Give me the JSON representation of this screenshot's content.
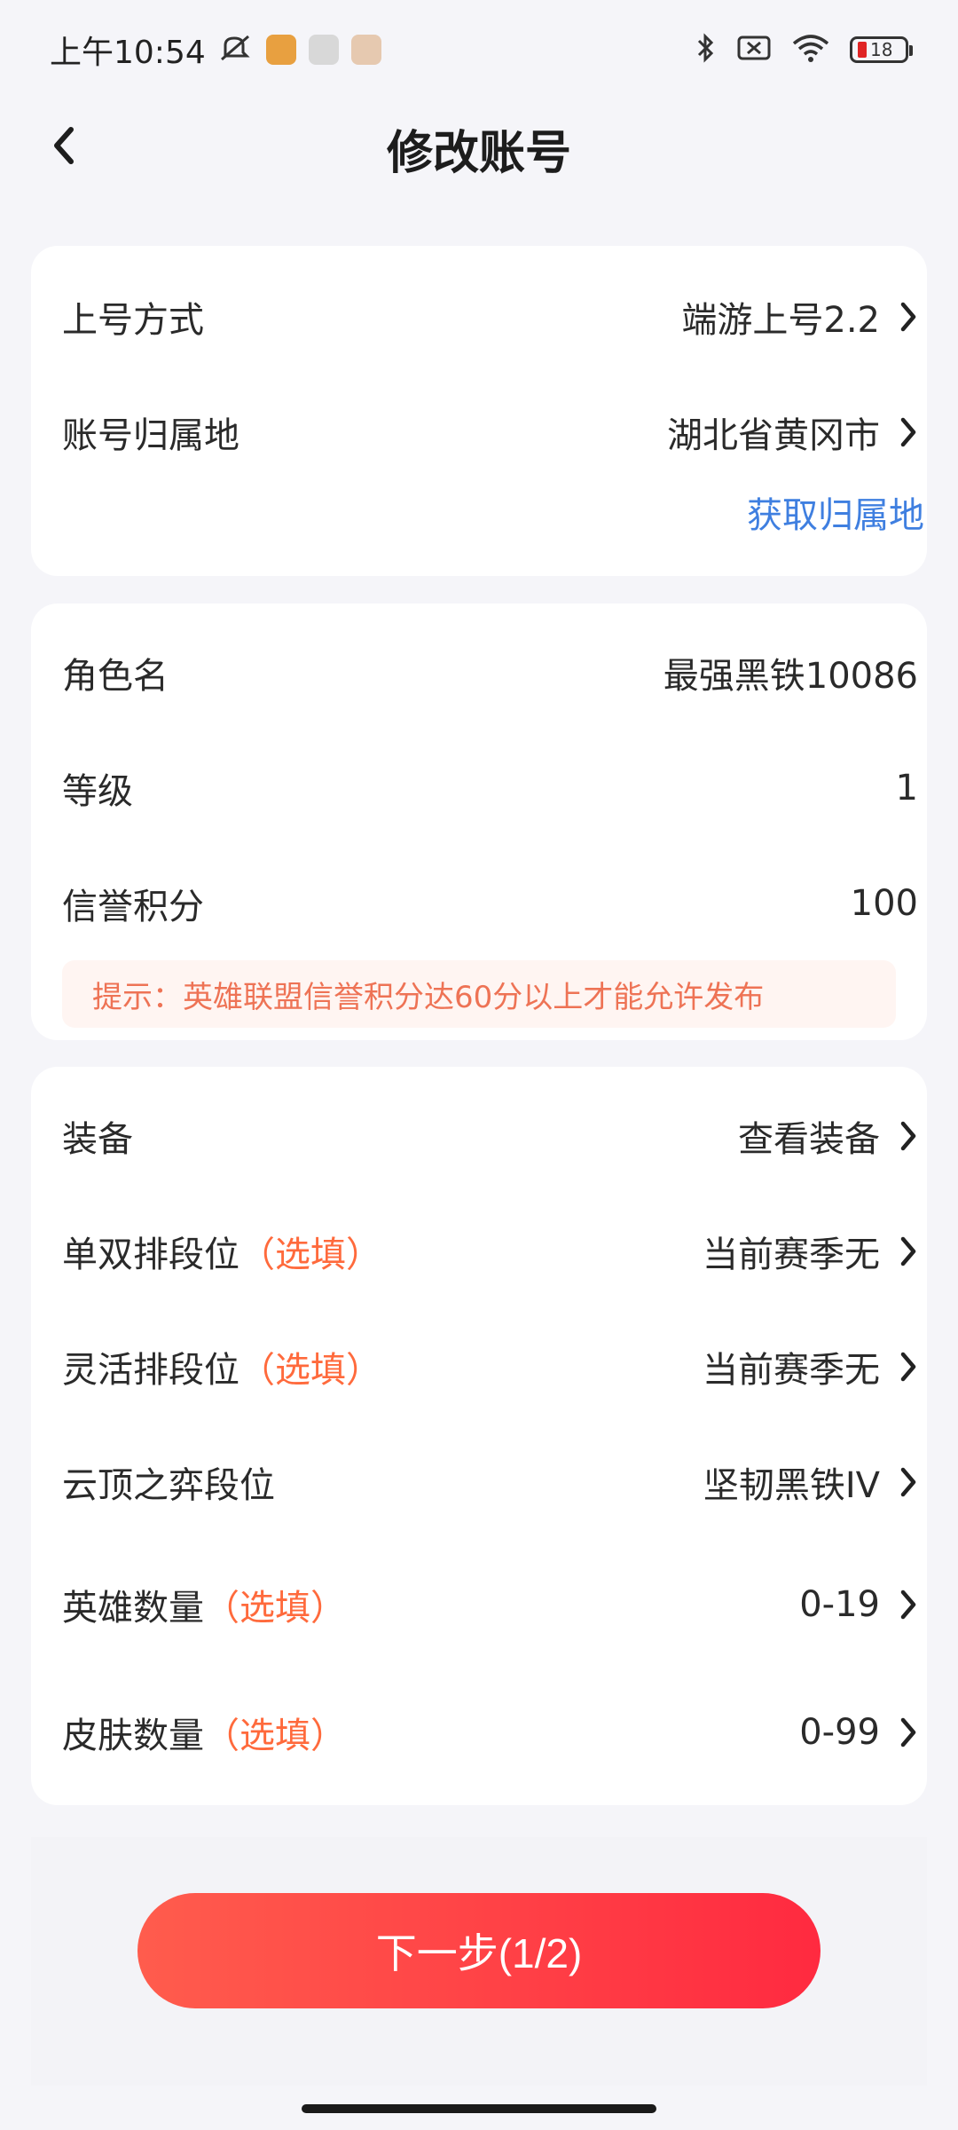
{
  "status_bar": {
    "time": "上午10:54",
    "battery_level": "18",
    "colors": {
      "battery_low": "#e02424"
    }
  },
  "nav": {
    "title": "修改账号"
  },
  "section1": {
    "login_method_label": "上号方式",
    "login_method_value": "端游上号2.2",
    "region_label": "账号归属地",
    "region_value": "湖北省黄冈市",
    "get_region_link": "获取归属地"
  },
  "section2": {
    "role_name_label": "角色名",
    "role_name_value": "最强黑铁10086",
    "level_label": "等级",
    "level_value": "1",
    "credit_label": "信誉积分",
    "credit_value": "100",
    "hint": "提示：英雄联盟信誉积分达60分以上才能允许发布"
  },
  "section3": {
    "optional_tag": "（选填）",
    "equipment_label": "装备",
    "equipment_value": "查看装备",
    "solo_rank_label": "单双排段位",
    "solo_rank_value": "当前赛季无",
    "flex_rank_label": "灵活排段位",
    "flex_rank_value": "当前赛季无",
    "tft_rank_label": "云顶之弈段位",
    "tft_rank_value": "坚韧黑铁IV",
    "hero_count_label": "英雄数量",
    "hero_count_value": "0-19",
    "skin_count_label": "皮肤数量",
    "skin_count_value": "0-99"
  },
  "bottom": {
    "next_button": "下一步(1/2)"
  },
  "colors": {
    "accent_red": "#ff2a40",
    "link_blue": "#3f7fe0",
    "optional_orange": "#ff6a3c"
  }
}
